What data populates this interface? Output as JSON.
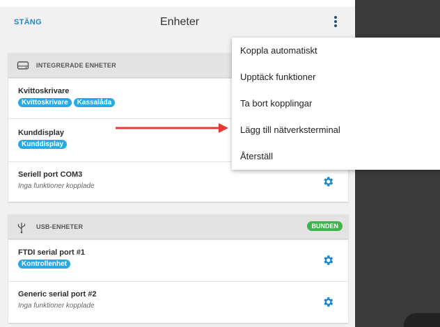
{
  "header": {
    "close_label": "STÄNG",
    "title": "Enheter",
    "more_icon": "more-vert-icon"
  },
  "integrated": {
    "header": "INTEGRERADE ENHETER",
    "icon": "hard-drive-icon",
    "devices": [
      {
        "name": "Kvittoskrivare",
        "tags": [
          "Kvittoskrivare",
          "Kassalåda"
        ]
      },
      {
        "name": "Kunddisplay",
        "tags": [
          "Kunddisplay"
        ]
      },
      {
        "name": "Seriell port COM3",
        "subtitle": "Inga funktioner kopplade"
      }
    ]
  },
  "usb": {
    "header": "USB-ENHETER",
    "icon": "usb-icon",
    "badge": "BUNDEN",
    "devices": [
      {
        "name": "FTDI serial port #1",
        "tags": [
          "Kontrollenhet"
        ]
      },
      {
        "name": "Generic serial port #2",
        "subtitle": "Inga funktioner kopplade"
      }
    ]
  },
  "menu": {
    "items": [
      "Koppla automatiskt",
      "Upptäck funktioner",
      "Ta bort kopplingar",
      "Lägg till nätverksterminal",
      "Återställ"
    ]
  },
  "colors": {
    "accent": "#1e88c8",
    "tag": "#29a9e1",
    "badge": "#3fb44b",
    "arrow": "#e53935"
  }
}
